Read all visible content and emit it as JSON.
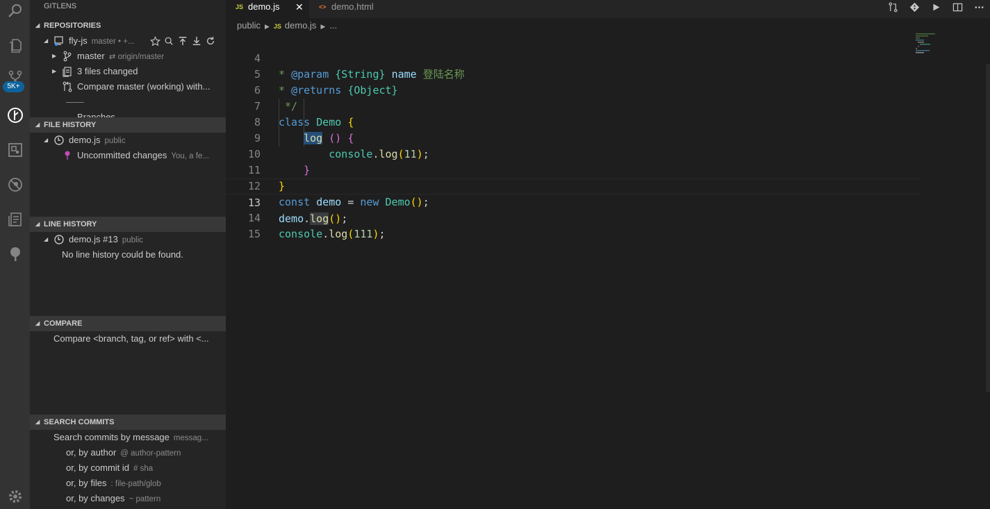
{
  "activity": {
    "badge": "5K+",
    "icons": [
      "search-icon",
      "explorer-icon",
      "source-control-icon",
      "gitlens-icon",
      "extensions-icon",
      "debug-icon",
      "notes-icon",
      "tree-icon",
      "settings-gear-icon"
    ]
  },
  "sidebar": {
    "title": "GITLENS",
    "repositories": {
      "header": "REPOSITORIES",
      "repo_name": "fly-js",
      "repo_desc": "master • +...",
      "branch": "master",
      "branch_desc": "⇄ origin/master",
      "files_changed": "3 files changed",
      "compare": "Compare master (working) with...",
      "separator": "——",
      "branches": "Branches"
    },
    "file_history": {
      "header": "FILE HISTORY",
      "file": "demo.js",
      "file_desc": "public",
      "uncommitted": "Uncommitted changes",
      "uncommitted_desc": "You, a fe..."
    },
    "line_history": {
      "header": "LINE HISTORY",
      "file": "demo.js #13",
      "file_desc": "public",
      "empty": "No line history could be found."
    },
    "compare": {
      "header": "COMPARE",
      "item": "Compare <branch, tag, or ref> with <..."
    },
    "search_commits": {
      "header": "SEARCH COMMITS",
      "items": [
        {
          "label": "Search commits by message",
          "desc": "messag..."
        },
        {
          "label": "or, by author",
          "desc": "@ author-pattern"
        },
        {
          "label": "or, by commit id",
          "desc": "# sha"
        },
        {
          "label": "or, by files",
          "desc": ": file-path/glob"
        },
        {
          "label": "or, by changes",
          "desc": "~ pattern"
        }
      ]
    }
  },
  "editor": {
    "tabs": [
      {
        "label": "demo.js",
        "icon": "JS",
        "active": true
      },
      {
        "label": "demo.html",
        "icon": "<>",
        "active": false
      }
    ],
    "close_glyph": "✕",
    "breadcrumb": [
      "public",
      "demo.js",
      "..."
    ],
    "breadcrumb_js": "JS",
    "line_numbers": [
      "4",
      "5",
      "6",
      "7",
      "8",
      "9",
      "10",
      "11",
      "12",
      "13",
      "14",
      "15"
    ],
    "current_line": "13"
  },
  "colors": {
    "activity_bar": "#333333",
    "sidebar": "#252526",
    "editor": "#1e1e1e",
    "badge": "#0e639c",
    "keyword": "#569cd6",
    "class": "#4ec9b0",
    "function": "#dcdcaa",
    "number": "#b5cea8",
    "comment": "#6a9955"
  }
}
